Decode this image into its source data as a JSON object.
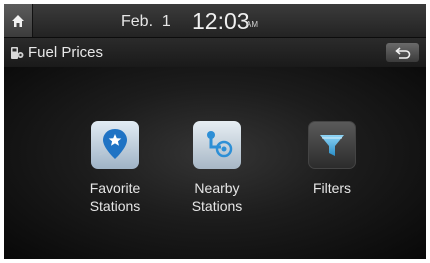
{
  "status_bar": {
    "home_icon": "home-icon",
    "date": "Feb.  1",
    "time": "12:03",
    "ampm": "AM"
  },
  "title_bar": {
    "icon": "fuel-pump-icon",
    "title": "Fuel Prices",
    "back_icon": "back-arrow-icon"
  },
  "menu": [
    {
      "label_line1": "Favorite",
      "label_line2": "Stations",
      "icon": "map-pin-star-icon"
    },
    {
      "label_line1": "Nearby",
      "label_line2": "Stations",
      "icon": "route-icon"
    },
    {
      "label_line1": "Filters",
      "label_line2": "",
      "icon": "funnel-icon"
    }
  ]
}
